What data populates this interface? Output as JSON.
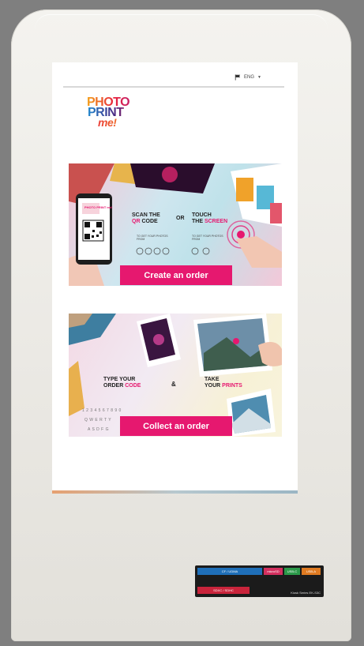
{
  "topbar": {
    "language": "ENG"
  },
  "logo": {
    "line1": "PHOTO",
    "line2": "PRINT",
    "line3": "me!"
  },
  "banner1": {
    "scan_line1": "SCAN THE",
    "scan_line2a": "QR",
    "scan_line2b": " CODE",
    "or": "OR",
    "touch_line1": "TOUCH",
    "touch_line2a": "THE ",
    "touch_line2b": "SCREEN",
    "scan_sub": "TO GET YOUR PHOTOS FROM",
    "touch_sub": "TO GET YOUR PHOTOS FROM",
    "phone_logo": "PHOTO PRINT me!",
    "button": "Create an order"
  },
  "banner2": {
    "type_line1": "TYPE YOUR",
    "type_line2a": "ORDER ",
    "type_line2b": "CODE",
    "amp": "&",
    "take_line1": "TAKE",
    "take_line2a": "YOUR ",
    "take_line2b": "PRINTS",
    "keys_row1": "1 2 3 4 5 6 7 8 9 0",
    "keys_row2": "Q W E R T Y",
    "keys_row3": "A S D F G",
    "button": "Collect an order"
  },
  "card_reader": {
    "slot_top": "CF / UDMA",
    "slot_sub": "microSD",
    "slot_usb": "USB-C",
    "slot_extra": "USB-A",
    "slot_bottom": "SDXC / SDHC",
    "brand": "Kiosk Series  EK-S3C"
  },
  "colors": {
    "accent": "#e6186f",
    "kiosk_body": "#efeeea",
    "background": "#7f7f7f"
  },
  "icons": [
    "flag-icon",
    "caret-down-icon",
    "qr-code-icon",
    "fingerprint-touch-icon"
  ]
}
